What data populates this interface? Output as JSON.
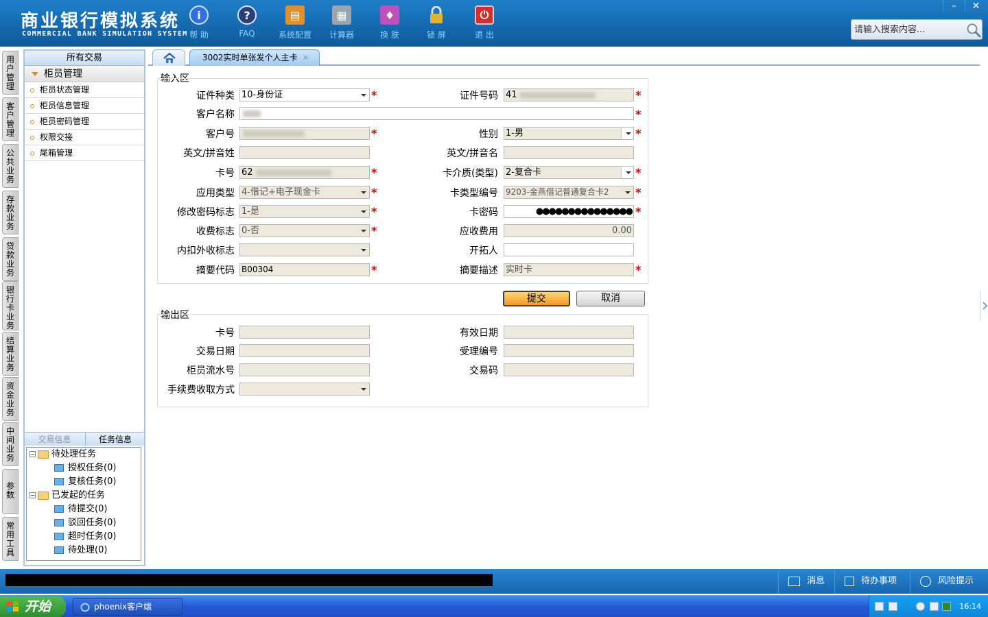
{
  "header": {
    "title_cn": "商业银行模拟系统",
    "title_en": "COMMERCIAL BANK SIMULATION SYSTEM",
    "toolbar": [
      {
        "name": "help",
        "label": "帮 助",
        "icon": "info-icon",
        "color": "#2f6fe0",
        "glyph": "i"
      },
      {
        "name": "faq",
        "label": "FAQ",
        "icon": "question-icon",
        "color": "#2a3e7a",
        "glyph": "?"
      },
      {
        "name": "config",
        "label": "系统配置",
        "icon": "toolbox-icon",
        "color": "#e0902a",
        "glyph": "▤"
      },
      {
        "name": "calculator",
        "label": "计算器",
        "icon": "calculator-icon",
        "color": "#9aa5b0",
        "glyph": "▦"
      },
      {
        "name": "skin",
        "label": "换 肤",
        "icon": "shirt-icon",
        "color": "#c050c0",
        "glyph": "♦"
      },
      {
        "name": "lock",
        "label": "锁 屏",
        "icon": "lock-icon",
        "color": "#d0a020",
        "glyph": "🔒"
      },
      {
        "name": "exit",
        "label": "退 出",
        "icon": "power-icon",
        "color": "#d03030",
        "glyph": "⏻"
      }
    ],
    "window_min": "–",
    "window_close": "✕",
    "search_placeholder": "请输入搜索内容..."
  },
  "vtabs": [
    "用户管理",
    "客户管理",
    "公共业务",
    "存款业务",
    "贷款业务",
    "银行卡业务",
    "结算业务",
    "资金业务",
    "中间业务",
    "参数",
    "常用工具"
  ],
  "leftpanel": {
    "header": "所有交易",
    "group": "柜员管理",
    "items": [
      "柜员状态管理",
      "柜员信息管理",
      "柜员密码管理",
      "权限交接",
      "尾箱管理"
    ],
    "bottom_tabs": [
      "交易信息",
      "任务信息"
    ],
    "tree": {
      "pending": "待处理任务",
      "authorize": "授权任务(0)",
      "review": "复核任务(0)",
      "initiated": "已发起的任务",
      "to_submit": "待提交(0)",
      "rejected": "驳回任务(0)",
      "timeout": "超时任务(0)",
      "to_handle": "待处理(0)"
    }
  },
  "tabs": {
    "active": "3002实时单张发个人主卡",
    "close": "×"
  },
  "input_area": {
    "title": "输入区",
    "id_type_label": "证件种类",
    "id_type": "10-身份证",
    "id_no_label": "证件号码",
    "id_no_prefix": "41",
    "cust_name_label": "客户名称",
    "cust_no_label": "客户号",
    "gender_label": "性别",
    "gender": "1-男",
    "en_last_label": "英文/拼音姓",
    "en_first_label": "英文/拼音名",
    "card_no_label": "卡号",
    "card_no_prefix": "62",
    "card_medium_label": "卡介质(类型)",
    "card_medium": "2-复合卡",
    "app_type_label": "应用类型",
    "app_type": "4-借记+电子现金卡",
    "card_type_no_label": "卡类型编号",
    "card_type_no": "9203-金燕借记普通复合卡2",
    "modify_pwd_label": "修改密码标志",
    "modify_pwd": "1-是",
    "card_pwd_label": "卡密码",
    "card_pwd": "●●●●●●●●●●●●●●●",
    "fee_flag_label": "收费标志",
    "fee_flag": "0-否",
    "fee_due_label": "应收费用",
    "fee_due": "0.00",
    "inner_outer_label": "内扣外收标志",
    "developer_label": "开拓人",
    "summary_code_label": "摘要代码",
    "summary_code": "B00304",
    "summary_desc_label": "摘要描述",
    "summary_desc": "实时卡",
    "required_mark": "*"
  },
  "buttons": {
    "submit": "提交",
    "cancel": "取消"
  },
  "output_area": {
    "title": "输出区",
    "card_no_label": "卡号",
    "expiry_label": "有效日期",
    "txn_date_label": "交易日期",
    "accept_no_label": "受理编号",
    "teller_serial_label": "柜员流水号",
    "txn_code_label": "交易码",
    "fee_method_label": "手续费收取方式"
  },
  "statusbar": {
    "messages": "消息",
    "todo": "待办事项",
    "risk": "风险提示"
  },
  "taskbar": {
    "start": "开始",
    "task": "phoenix客户端",
    "clock": "16:14"
  }
}
